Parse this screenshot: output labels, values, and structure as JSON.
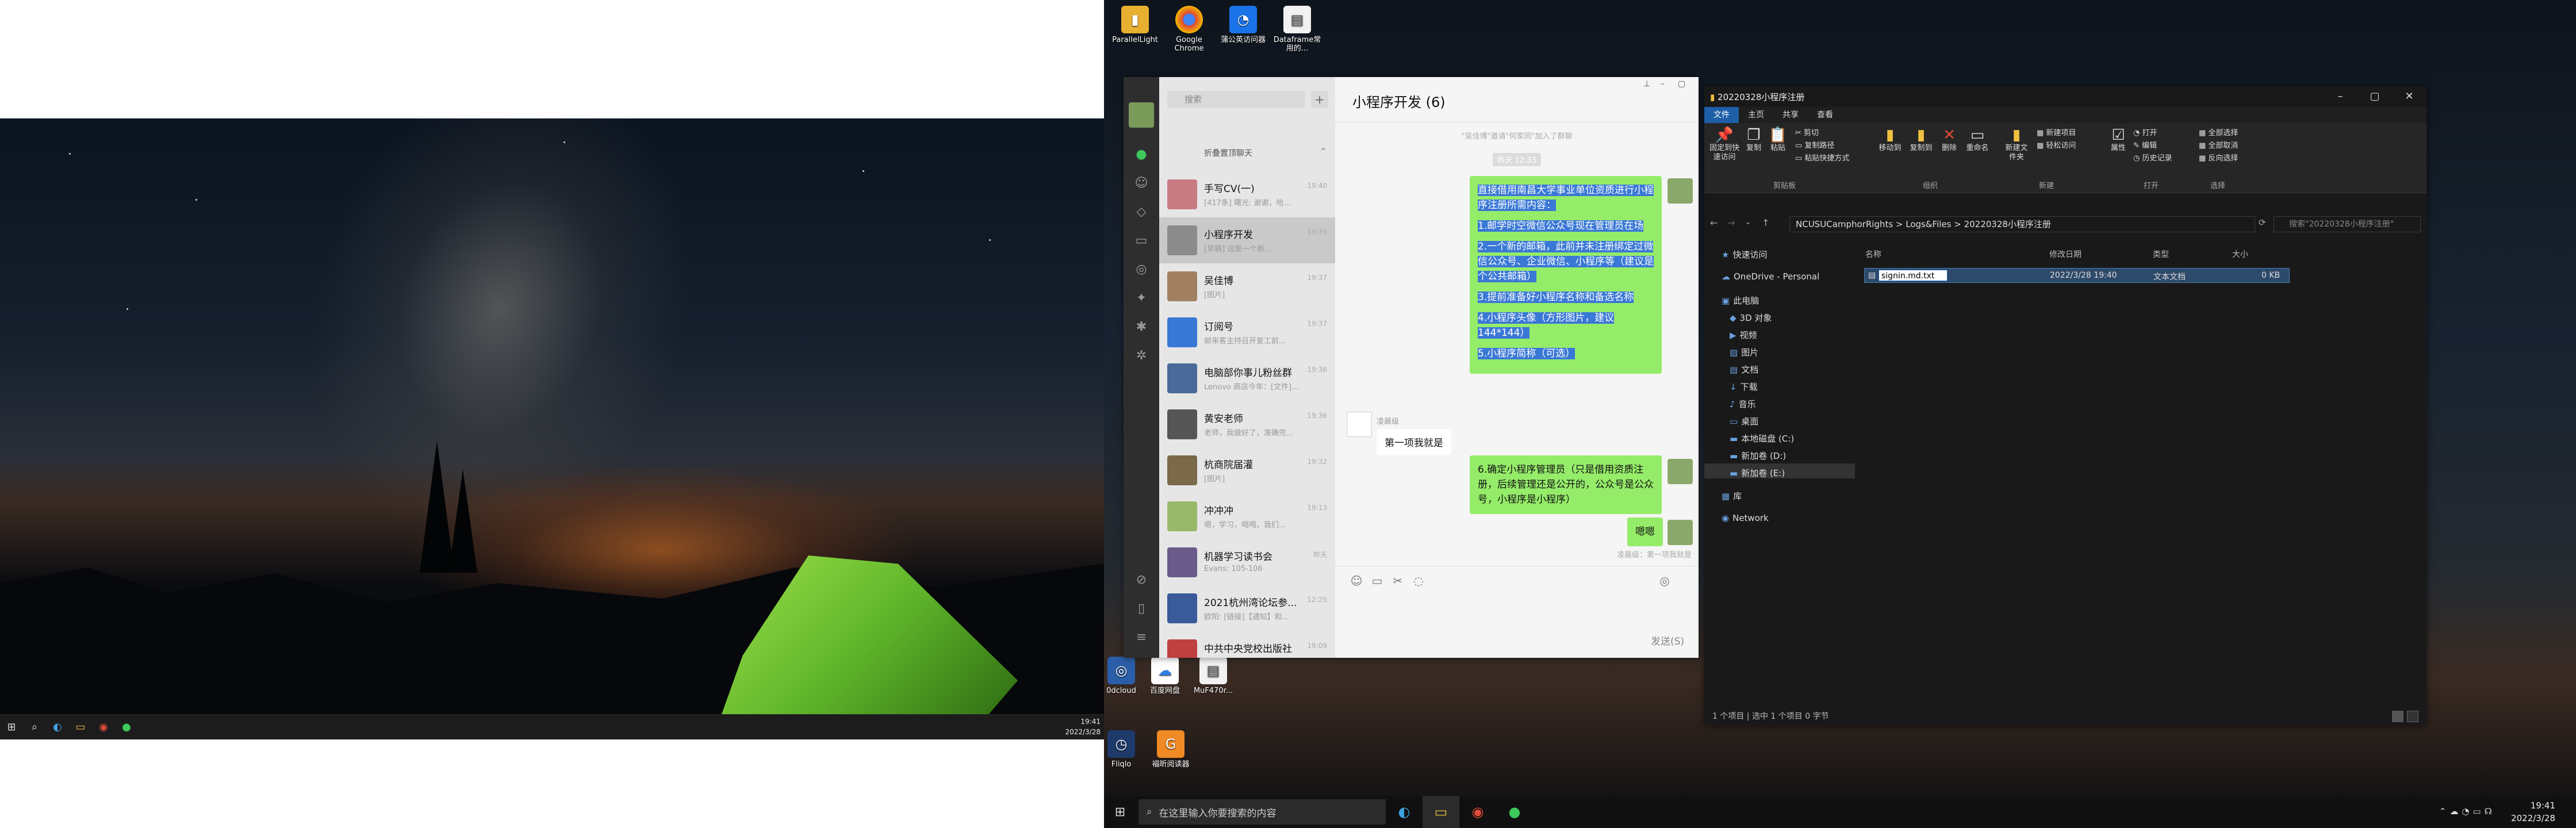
{
  "left_taskbar": {
    "time": "19:41",
    "date": "2022/3/28"
  },
  "right_taskbar": {
    "search_placeholder": "在这里输入你要搜索的内容",
    "time": "19:41",
    "date": "2022/3/28"
  },
  "desktop_icons": [
    {
      "label": "ParallelLight"
    },
    {
      "label": "Google Chrome"
    },
    {
      "label": "蒲公英访问器"
    },
    {
      "label": "Dataframe常用的..."
    },
    {
      "label": "0dcloud"
    },
    {
      "label": "百度网盘"
    },
    {
      "label": "MuF470r..."
    },
    {
      "label": "Fliqlo"
    },
    {
      "label": "福昕阅读器"
    }
  ],
  "wechat": {
    "search_placeholder": "搜索",
    "folded_label": "折叠置顶聊天",
    "chats": [
      {
        "name": "手写CV(一)",
        "preview": "[417条] 曙光: 谢谢，哈...",
        "time": "19:40"
      },
      {
        "name": "小程序开发",
        "preview": "[草稿] 这是一个新...",
        "time": "19:39"
      },
      {
        "name": "吴佳博",
        "preview": "[图片]",
        "time": "19:37"
      },
      {
        "name": "订阅号",
        "preview": "邮来客主持召开复工前...",
        "time": "19:37"
      },
      {
        "name": "电脑部你事儿粉丝群",
        "preview": "Lenovo 商店今年：[文件]...",
        "time": "19:36"
      },
      {
        "name": "黄安老师",
        "preview": "老师，我做好了，准确完...",
        "time": "19:36"
      },
      {
        "name": "杭商院届灌",
        "preview": "[图片]",
        "time": "19:32"
      },
      {
        "name": "冲冲冲",
        "preview": "嗯，学习，喝喝，我们...",
        "time": "19:13"
      },
      {
        "name": "机器学习读书会",
        "preview": "Evans: 105-106",
        "time": "昨天"
      },
      {
        "name": "2021杭州湾论坛参...",
        "preview": "欧阳: [链接]【通知】和...",
        "time": "12:25"
      },
      {
        "name": "中共中央党校出版社",
        "preview": "",
        "time": "19:09"
      }
    ],
    "chat_title": "小程序开发 (6)",
    "system_note": "\"吴佳博\"邀请\"何家同\"加入了群聊",
    "time_badge": "昨天 12:33",
    "msg_lines": [
      "直接借用南昌大学事业单位资质进行小程序注册所需内容：",
      "1.邮学时空微信公众号现在管理员在场",
      "2.一个新的邮箱，此前并未注册绑定过微信公众号、企业微信、小程序等（建议是个公共邮箱）",
      "3.提前准备好小程序名称和备选名称",
      "4.小程序头像（方形图片，建议144*144）",
      "5.小程序简称（可选）"
    ],
    "reply_sender": "凌晨级",
    "reply_text": "第一项我就是",
    "msg2": "6.确定小程序管理员（只是借用资质注册，后续管理还是公开的，公众号是公众号，小程序是小程序）",
    "msg3": "嗯嗯",
    "quote_note": "凌晨级：第一项我就是",
    "send_label": "发送(S)"
  },
  "explorer": {
    "title": "20220328小程序注册",
    "tabs": [
      "文件",
      "主页",
      "共享",
      "查看"
    ],
    "ribbon": {
      "pin": "固定到快速访问",
      "copy": "复制",
      "paste": "粘贴",
      "cut": "剪切",
      "copy_path": "复制路径",
      "paste_shortcut": "粘贴快捷方式",
      "move_to": "移动到",
      "copy_to": "复制到",
      "delete": "删除",
      "rename": "重命名",
      "new_folder": "新建文件夹",
      "new_item": "新建项目",
      "easy_access": "轻松访问",
      "properties": "属性",
      "open": "打开",
      "edit": "编辑",
      "history": "历史记录",
      "select_all": "全部选择",
      "select_none": "全部取消",
      "invert": "反向选择",
      "groups": [
        "剪贴板",
        "组织",
        "新建",
        "打开",
        "选择"
      ]
    },
    "path": [
      "NCUSUCamphorRights",
      "Logs&Files",
      "20220328小程序注册"
    ],
    "search_placeholder": "搜索\"20220328小程序注册\"",
    "columns": [
      "名称",
      "修改日期",
      "类型",
      "大小"
    ],
    "nav": [
      "快速访问",
      "OneDrive - Personal",
      "此电脑",
      "3D 对象",
      "视频",
      "图片",
      "文档",
      "下载",
      "音乐",
      "桌面",
      "本地磁盘 (C:)",
      "新加卷 (D:)",
      "新加卷 (E:)",
      "库",
      "Network"
    ],
    "file": {
      "name": "signin.md.txt",
      "modified": "2022/3/28 19:40",
      "type": "文本文档",
      "size": "0 KB"
    },
    "status": "1 个项目  |  选中 1 个项目 0 字节"
  }
}
